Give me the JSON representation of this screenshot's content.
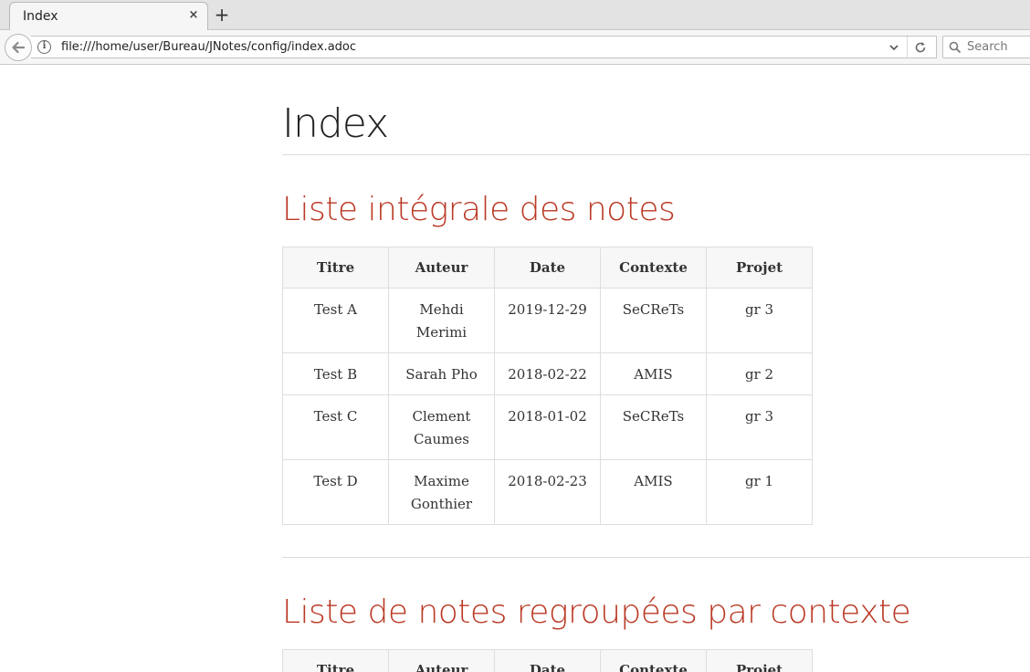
{
  "browser": {
    "tab_title": "Index",
    "tab_close": "×",
    "new_tab": "+",
    "url": "file:///home/user/Bureau/JNotes/config/index.adoc",
    "search_placeholder": "Search"
  },
  "page": {
    "title": "Index",
    "section1_title": "Liste intégrale des notes",
    "section2_title": "Liste de notes regroupées par contexte"
  },
  "table": {
    "headers": [
      "Titre",
      "Auteur",
      "Date",
      "Contexte",
      "Projet"
    ],
    "rows": [
      [
        "Test A",
        "Mehdi Merimi",
        "2019-12-29",
        "SeCReTs",
        "gr 3"
      ],
      [
        "Test B",
        "Sarah Pho",
        "2018-02-22",
        "AMIS",
        "gr 2"
      ],
      [
        "Test C",
        "Clement Caumes",
        "2018-01-02",
        "SeCReTs",
        "gr 3"
      ],
      [
        "Test D",
        "Maxime Gonthier",
        "2018-02-23",
        "AMIS",
        "gr 1"
      ]
    ]
  },
  "table2": {
    "headers": [
      "Titre",
      "Auteur",
      "Date",
      "Contexte",
      "Projet"
    ]
  },
  "colors": {
    "section_title": "#ba3925",
    "title": "#222222",
    "table_header_bg": "#f7f7f8",
    "border": "#dedede"
  },
  "icons": {
    "back": "back-arrow-icon",
    "info": "info-icon",
    "dropdown": "chevron-down-icon",
    "reload": "reload-icon",
    "search": "search-icon"
  }
}
